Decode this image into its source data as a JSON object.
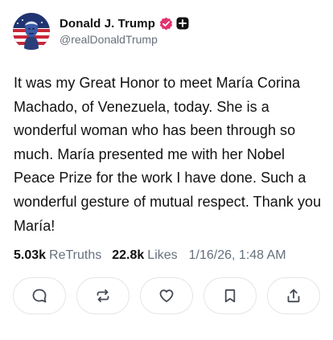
{
  "author": {
    "display_name": "Donald J. Trump",
    "username": "@realDonaldTrump",
    "verified": true,
    "avatar_icon": "avatar-flag-portrait",
    "verified_color": "#e3326e"
  },
  "post": {
    "text": "It was my Great Honor to meet María Corina Machado, of Venezuela, today. She is a wonderful woman who has been through so much. María presented me with her Nobel Peace Prize for the work I have done. Such a wonderful gesture of mutual respect. Thank you María!"
  },
  "stats": {
    "retruths_count": "5.03k",
    "retruths_label": "ReTruths",
    "likes_count": "22.8k",
    "likes_label": "Likes",
    "timestamp": "1/16/26, 1:48 AM"
  },
  "actions": [
    {
      "icon": "reply-icon"
    },
    {
      "icon": "retruth-icon"
    },
    {
      "icon": "like-icon"
    },
    {
      "icon": "bookmark-icon"
    },
    {
      "icon": "share-icon"
    }
  ]
}
